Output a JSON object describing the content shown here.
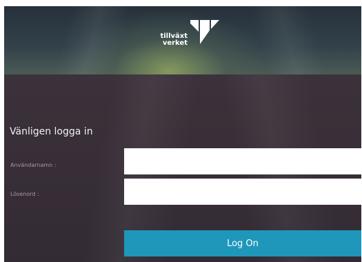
{
  "brand": {
    "logo_line1": "tillväxt",
    "logo_line2": "verket",
    "logo_icon": "tillvaxtverket-logo-icon"
  },
  "login": {
    "title": "Vänligen logga in",
    "username_label": "Användarnamn :",
    "username_value": "",
    "password_label": "Lösenord :",
    "password_value": "",
    "submit_label": "Log On"
  },
  "colors": {
    "button": "#1f97bb",
    "background": "#3a3039",
    "header": "#33424a"
  }
}
